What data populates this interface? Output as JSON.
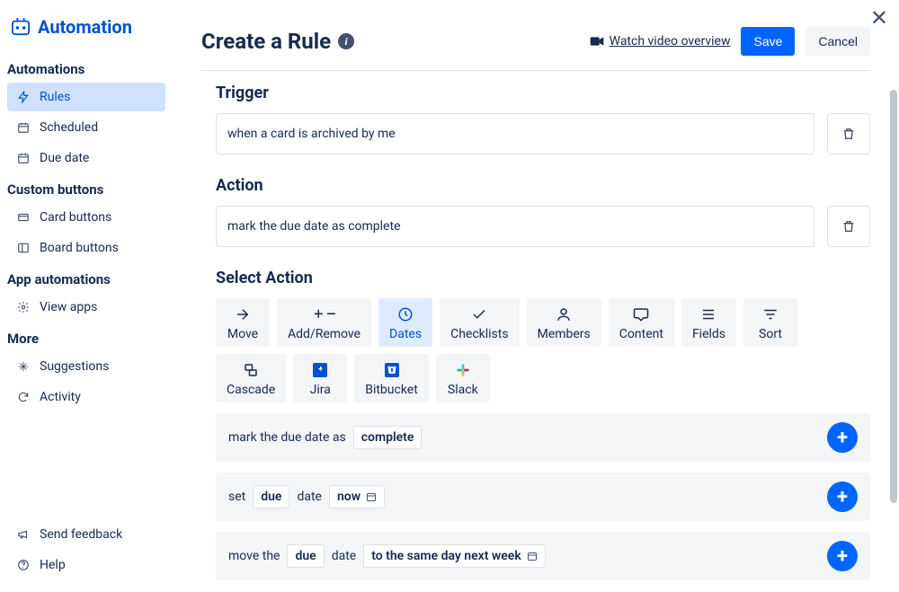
{
  "close_label": "✕",
  "sidebar": {
    "title": "Automation",
    "sections": {
      "automations": {
        "label": "Automations",
        "items": [
          {
            "label": "Rules",
            "icon": "flash"
          },
          {
            "label": "Scheduled",
            "icon": "calendar"
          },
          {
            "label": "Due date",
            "icon": "calendar"
          }
        ]
      },
      "custom_buttons": {
        "label": "Custom buttons",
        "items": [
          {
            "label": "Card buttons",
            "icon": "card"
          },
          {
            "label": "Board buttons",
            "icon": "board"
          }
        ]
      },
      "app_automations": {
        "label": "App automations",
        "items": [
          {
            "label": "View apps",
            "icon": "gear"
          }
        ]
      },
      "more": {
        "label": "More",
        "items": [
          {
            "label": "Suggestions",
            "icon": "sparkle"
          },
          {
            "label": "Activity",
            "icon": "refresh"
          }
        ]
      }
    },
    "footer": [
      {
        "label": "Send feedback",
        "icon": "megaphone"
      },
      {
        "label": "Help",
        "icon": "help"
      }
    ]
  },
  "header": {
    "title": "Create a Rule",
    "video_link": "Watch video overview",
    "save": "Save",
    "cancel": "Cancel"
  },
  "trigger": {
    "heading": "Trigger",
    "summary": "when a card is archived by me"
  },
  "action": {
    "heading": "Action",
    "summary": "mark the due date as complete"
  },
  "select_action": {
    "heading": "Select Action",
    "tabs": [
      {
        "label": "Move",
        "icon": "arrow-right"
      },
      {
        "label": "Add/Remove",
        "icon": "plus-minus"
      },
      {
        "label": "Dates",
        "icon": "clock",
        "active": true
      },
      {
        "label": "Checklists",
        "icon": "check"
      },
      {
        "label": "Members",
        "icon": "person"
      },
      {
        "label": "Content",
        "icon": "speech"
      },
      {
        "label": "Fields",
        "icon": "lines"
      },
      {
        "label": "Sort",
        "icon": "filter"
      },
      {
        "label": "Cascade",
        "icon": "cascade"
      },
      {
        "label": "Jira",
        "icon": "jira"
      },
      {
        "label": "Bitbucket",
        "icon": "bitbucket"
      },
      {
        "label": "Slack",
        "icon": "slack"
      }
    ]
  },
  "options": [
    {
      "prefix": "mark the due date as",
      "chips": [
        "complete"
      ],
      "suffix": ""
    },
    {
      "prefix": "set",
      "chips": [
        "due"
      ],
      "mid": "date",
      "chips2": [
        "now"
      ],
      "calendar": true
    },
    {
      "prefix": "move the",
      "chips": [
        "due"
      ],
      "mid": "date",
      "chips2": [
        "to the same day next week"
      ],
      "calendar": true
    }
  ]
}
